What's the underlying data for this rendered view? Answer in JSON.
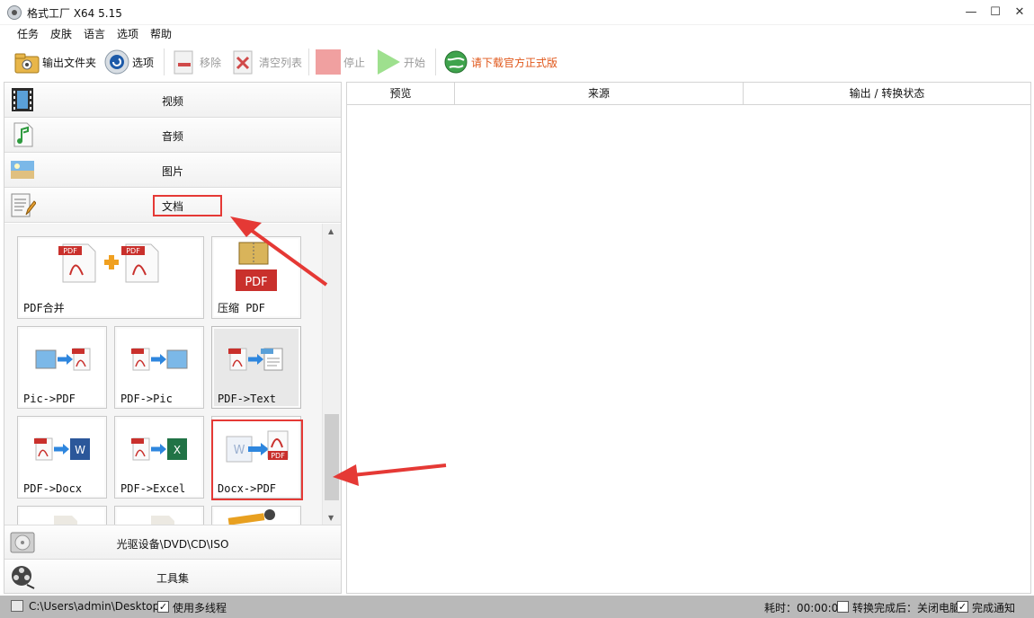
{
  "window": {
    "title": "格式工厂 X64 5.15",
    "minimize": "—",
    "maximize": "☐",
    "close": "✕"
  },
  "menu": [
    "任务",
    "皮肤",
    "语言",
    "选项",
    "帮助"
  ],
  "toolbar": {
    "output_folder": "输出文件夹",
    "options": "选项",
    "remove": "移除",
    "clear_list": "清空列表",
    "stop": "停止",
    "start": "开始",
    "download": "请下载官方正式版",
    "download_color": "#e0571a"
  },
  "categories": {
    "video": "视频",
    "audio": "音频",
    "picture": "图片",
    "document": "文档",
    "optical": "光驱设备\\DVD\\CD\\ISO",
    "tools": "工具集"
  },
  "tiles": [
    "PDF合并",
    "压缩 PDF",
    "Pic->PDF",
    "PDF->Pic",
    "PDF->Text",
    "PDF->Docx",
    "PDF->Excel",
    "Docx->PDF"
  ],
  "task_columns": {
    "preview": "预览",
    "source": "来源",
    "output_status": "输出 / 转换状态"
  },
  "statusbar": {
    "path": "C:\\Users\\admin\\Desktop",
    "multithread": "使用多线程",
    "multithread_checked": true,
    "elapsed": "耗时：00:00:00",
    "after_convert": "转换完成后：关闭电脑",
    "after_convert_checked": false,
    "notify": "完成通知",
    "notify_checked": true
  },
  "colors": {
    "highlight_red": "#e53935",
    "pdf_red": "#c9302c",
    "word_blue": "#2b579a",
    "excel_green": "#217346"
  }
}
